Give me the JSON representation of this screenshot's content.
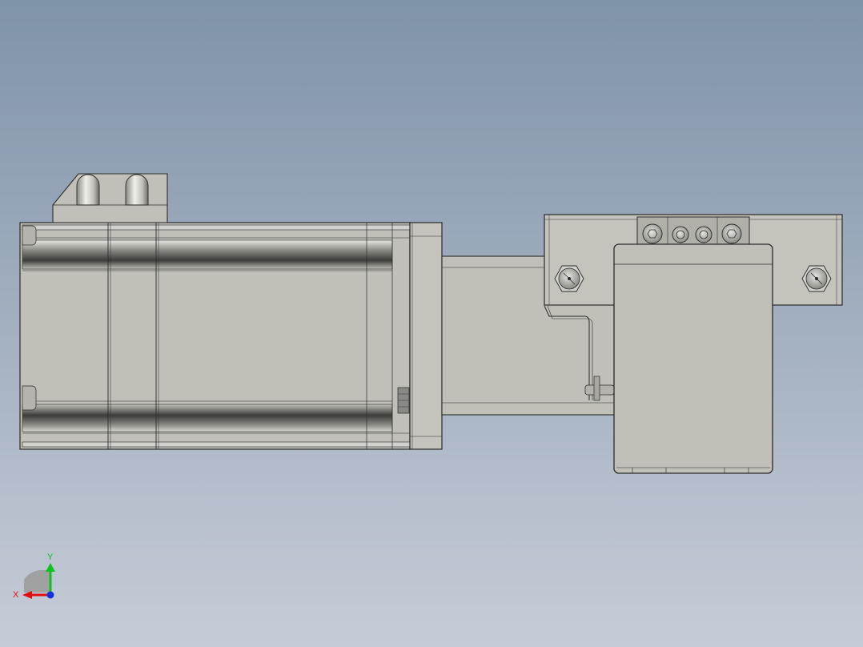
{
  "scene": {
    "background_top": "#7f93a9",
    "background_bottom": "#c6ccd7",
    "part_face": "#c0c0b8",
    "part_edge": "#2a2a2a",
    "shadow": "#3c3c38"
  },
  "triad": {
    "x_label": "X",
    "y_label": "Y",
    "x_color": "#e01010",
    "y_color": "#10c020",
    "z_color": "#1030e0"
  }
}
